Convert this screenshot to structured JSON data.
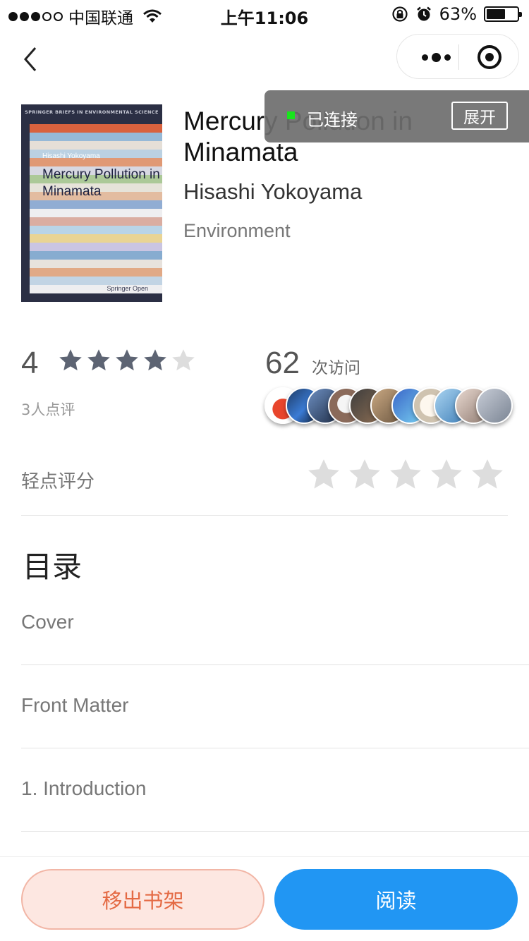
{
  "status_bar": {
    "carrier": "中国联通",
    "time": "上午11:06",
    "battery": "63%",
    "battery_level": 0.63,
    "signal_bars_filled": 3,
    "signal_bars_total": 5,
    "icons": [
      "wifi-icon",
      "rotation-lock-icon",
      "alarm-icon",
      "battery-icon"
    ]
  },
  "nav": {
    "back_icon": "chevron-left-icon",
    "more_icon": "more-dots-icon",
    "close_icon": "target-close-icon"
  },
  "book": {
    "title": "Mercury Pollution in Minamata",
    "author": "Hisashi Yokoyama",
    "category": "Environment",
    "cover": {
      "series": "SPRINGER BRIEFS IN ENVIRONMENTAL SCIENCE",
      "author": "Hisashi Yokoyama",
      "title": "Mercury Pollution in Minamata",
      "publisher": "Springer Open"
    }
  },
  "overlay": {
    "status": "已连接",
    "expand_label": "展开",
    "indicator_color": "#18e51c"
  },
  "stats": {
    "score": "4",
    "score_stars_filled": 4,
    "score_stars_total": 5,
    "raters": "3人点评",
    "visits": "62",
    "visits_label": "次访问",
    "visitor_avatar_count": 11
  },
  "rating": {
    "label": "轻点评分",
    "stars_total": 5
  },
  "toc": {
    "title": "目录",
    "items": [
      "Cover",
      "Front Matter",
      "1. Introduction"
    ]
  },
  "actions": {
    "remove_label": "移出书架",
    "read_label": "阅读"
  },
  "colors": {
    "primary_blue": "#2196f3",
    "remove_text": "#e46a44",
    "remove_bg": "#fde7e1",
    "star_dark": "#5d6473",
    "star_light": "#dddddd"
  }
}
